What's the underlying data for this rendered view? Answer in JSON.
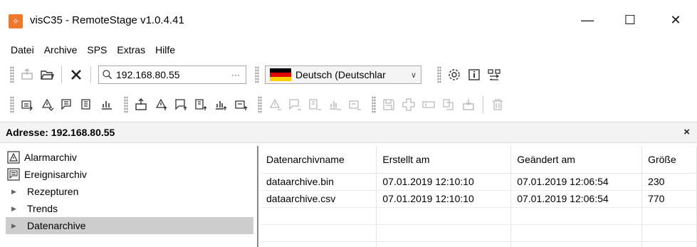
{
  "window": {
    "title": "visC35 - RemoteStage v1.0.4.41",
    "controls": {
      "minimize": "—",
      "maximize": "☐",
      "close": "✕"
    }
  },
  "menubar": [
    "Datei",
    "Archive",
    "SPS",
    "Extras",
    "Hilfe"
  ],
  "toolbar1": {
    "search_value": "192.168.80.55",
    "search_more": "···",
    "language": "Deutsch (Deutschlar",
    "flag_colors": [
      "#000000",
      "#dd0000",
      "#ffce00"
    ]
  },
  "address": {
    "label": "Adresse: 192.168.80.55",
    "close": "×"
  },
  "tree": {
    "items": [
      {
        "label": "Alarmarchiv",
        "type": "leaf",
        "icon": "alarm-icon"
      },
      {
        "label": "Ereignisarchiv",
        "type": "leaf",
        "icon": "event-icon"
      },
      {
        "label": "Rezepturen",
        "type": "folder",
        "arrow": "▶"
      },
      {
        "label": "Trends",
        "type": "folder",
        "arrow": "▶"
      },
      {
        "label": "Datenarchive",
        "type": "folder",
        "arrow": "▶",
        "selected": true
      }
    ]
  },
  "grid": {
    "columns": [
      "Datenarchivname",
      "Erstellt am",
      "Geändert am",
      "Größe"
    ],
    "rows": [
      [
        "dataarchive.bin",
        "07.01.2019 12:10:10",
        "07.01.2019 12:06:54",
        "230"
      ],
      [
        "dataarchive.csv",
        "07.01.2019 12:10:10",
        "07.01.2019 12:06:54",
        "770"
      ]
    ]
  },
  "colors": {
    "accent": "#f0782c",
    "selection": "#cdcdcd",
    "address_bg": "#f3f3f3"
  }
}
